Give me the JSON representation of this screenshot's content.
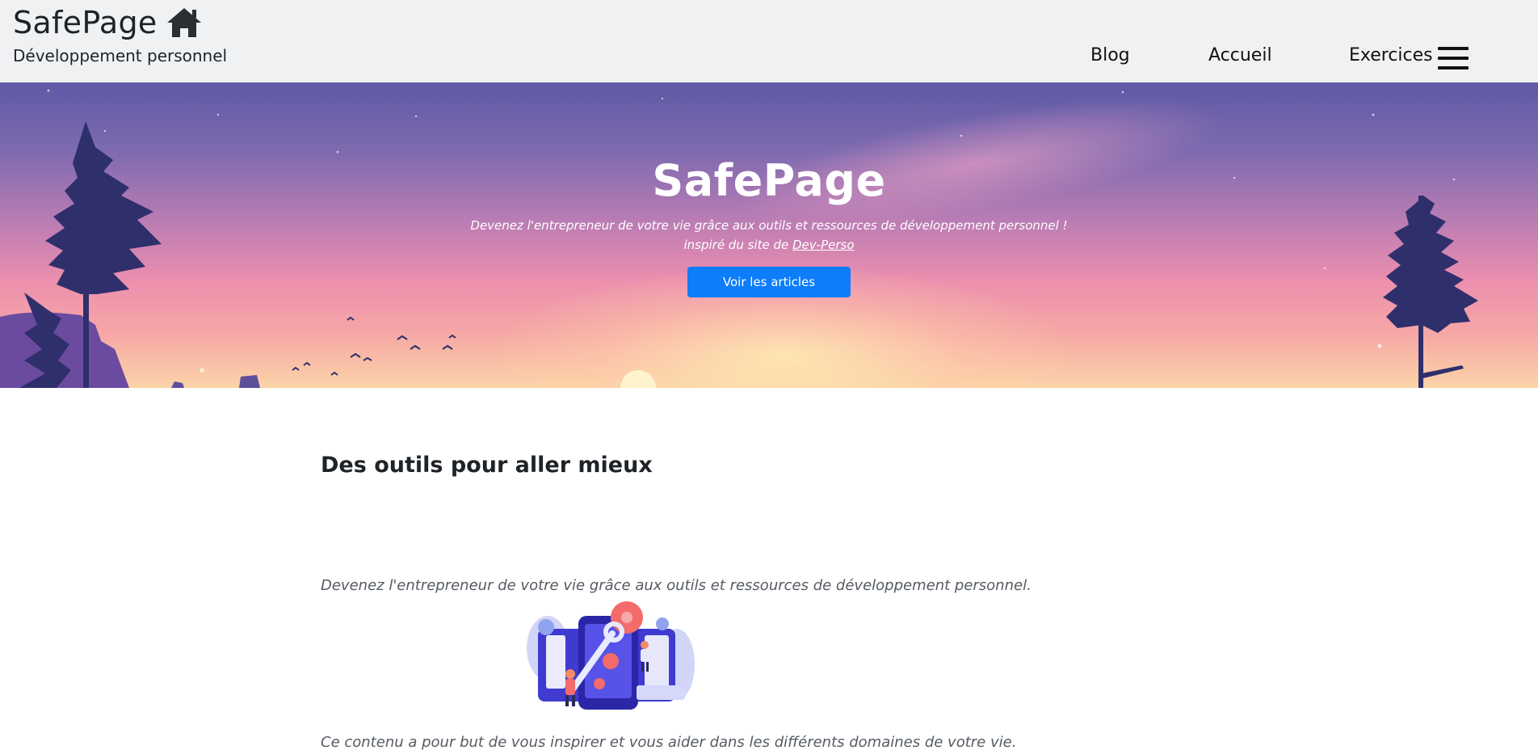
{
  "header": {
    "brand_title": "SafePage",
    "brand_icon": "home-icon",
    "brand_subtitle": "Développement personnel",
    "nav": {
      "blog": "Blog",
      "accueil": "Accueil",
      "exercices": "Exercices"
    },
    "menu_icon": "hamburger-menu-icon"
  },
  "hero": {
    "title": "SafePage",
    "subtitle": "Devenez l'entrepreneur de votre vie grâce aux outils et ressources de développement personnel !",
    "inspired_prefix": "inspiré du site de ",
    "inspired_link": "Dev-Perso",
    "button_label": "Voir les articles"
  },
  "content": {
    "section_title": "Des outils pour aller mieux",
    "lead": "Devenez l'entrepreneur de votre vie grâce aux outils et ressources de développement personnel.",
    "illustration": "tools-illustration",
    "paragraph": "Ce contenu a pour but de vous inspirer et vous aider dans les différents domaines de votre vie."
  },
  "colors": {
    "header_bg": "#f0f1f3",
    "button_bg": "#0d7dfa",
    "silhouette": "#2f2f6b"
  }
}
